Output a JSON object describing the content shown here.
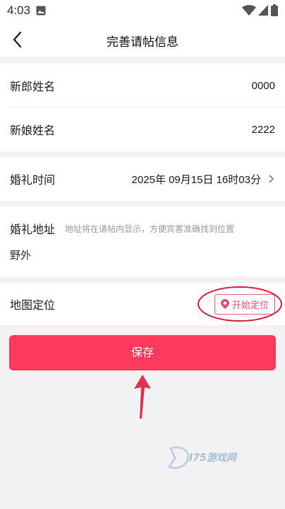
{
  "status_bar": {
    "time": "4:03",
    "icons": [
      "image-icon",
      "wifi-icon",
      "signal-icon",
      "battery-icon"
    ]
  },
  "header": {
    "title": "完善请帖信息",
    "back_icon": "chevron-left-icon"
  },
  "couple": {
    "groom_label": "新郎姓名",
    "groom_value": "0000",
    "bride_label": "新娘姓名",
    "bride_value": "2222"
  },
  "wedding_time": {
    "label": "婚礼时间",
    "value": "2025年 09月15日 16时03分"
  },
  "wedding_address": {
    "label": "婚礼地址",
    "hint": "地址将在请帖内显示，方便宾客准确找到位置",
    "value": "野外"
  },
  "map_location": {
    "label": "地图定位",
    "button_label": "开始定位",
    "button_icon": "location-pin-icon"
  },
  "save_button_label": "保存",
  "watermark": {
    "text": "I75游戏网"
  },
  "colors": {
    "accent": "#fd3a5b",
    "annotation": "#d7263d",
    "background": "#f2f2f4"
  }
}
